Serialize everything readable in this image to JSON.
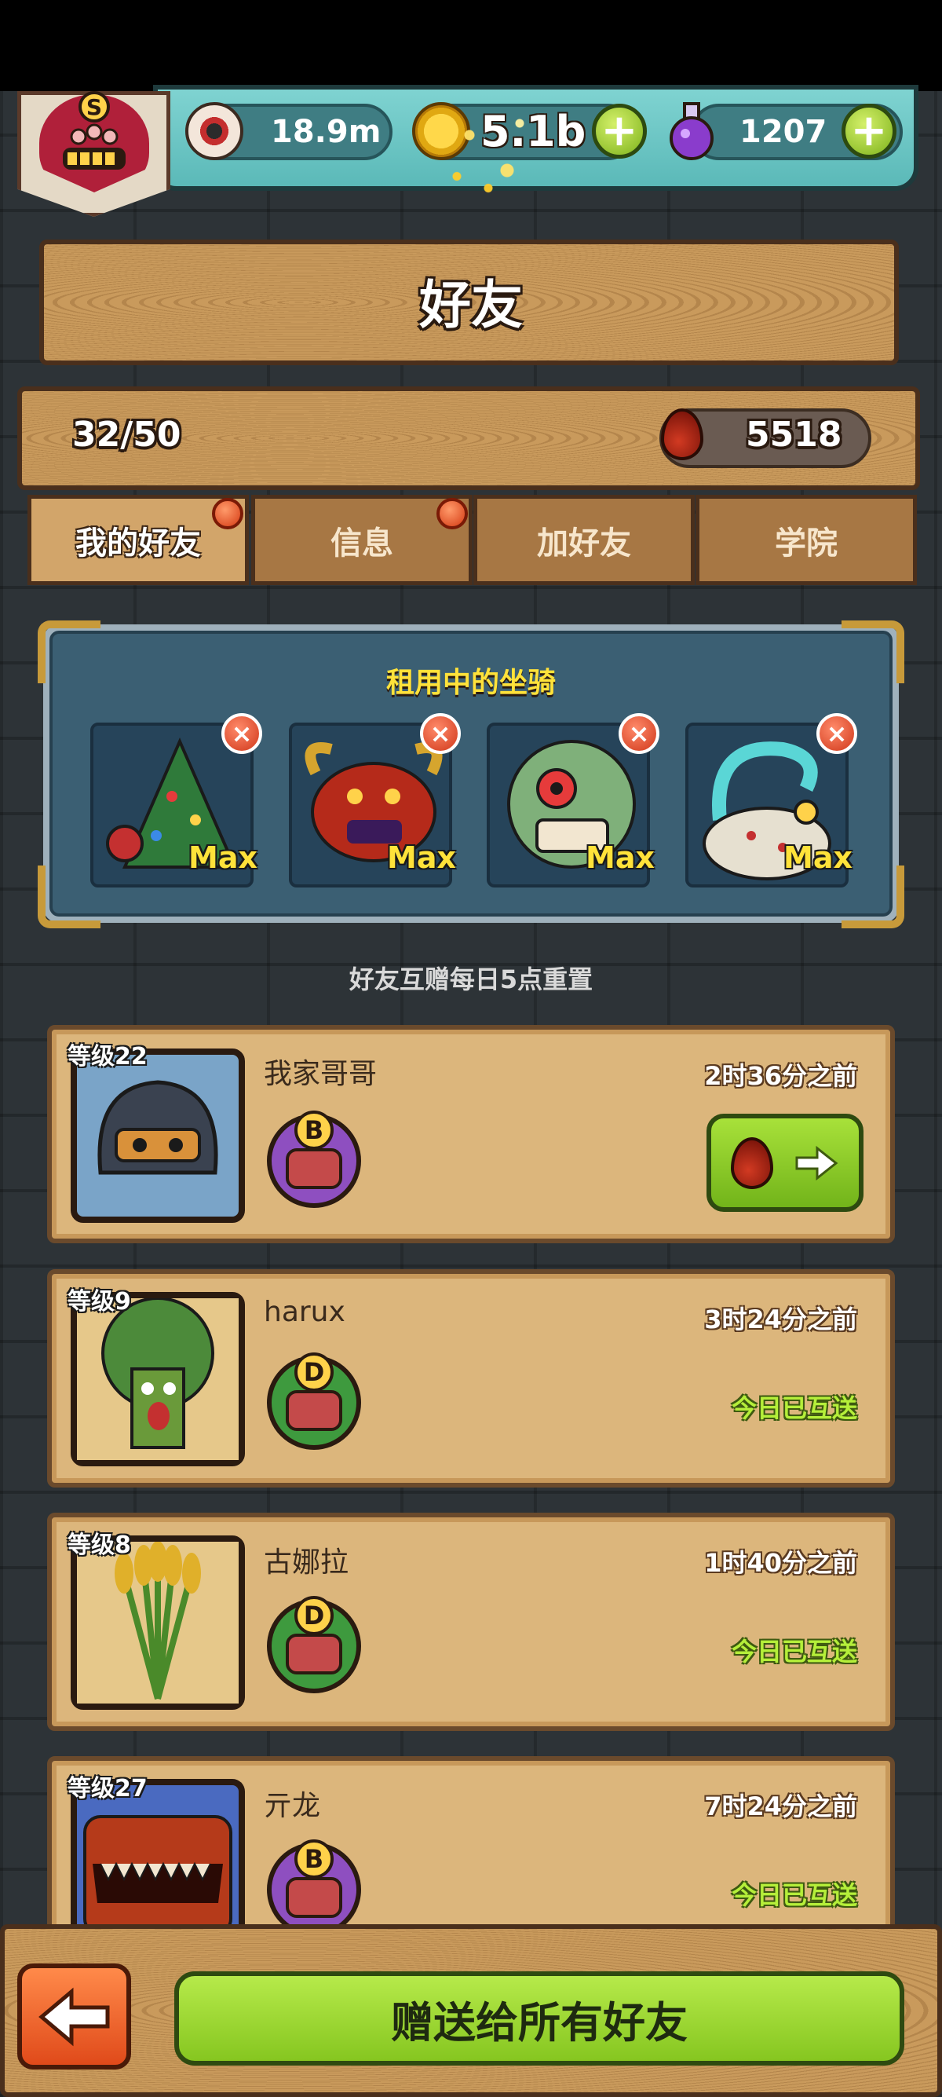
{
  "resources": {
    "eyes": "18.9m",
    "coins": "5.1b",
    "potions": "1207"
  },
  "page_title": "好友",
  "friend_count": "32/50",
  "blood_drops": "5518",
  "tabs": [
    {
      "label": "我的好友",
      "active": true,
      "notification": true
    },
    {
      "label": "信息",
      "active": false,
      "notification": true
    },
    {
      "label": "加好友",
      "active": false,
      "notification": false
    },
    {
      "label": "学院",
      "active": false,
      "notification": false
    }
  ],
  "mounts": {
    "title": "租用中的坐骑",
    "items": [
      {
        "name": "christmas-tree-monster",
        "level": "Max"
      },
      {
        "name": "horned-demon-monster",
        "level": "Max"
      },
      {
        "name": "lion-dance-monster",
        "level": "Max"
      },
      {
        "name": "snail-blob-monster",
        "level": "Max"
      }
    ]
  },
  "reset_note": "好友互赠每日5点重置",
  "friends": [
    {
      "level": "等级22",
      "name": "我家哥哥",
      "time": "2时36分之前",
      "rank": "B",
      "status": "gift_button"
    },
    {
      "level": "等级9",
      "name": "harux",
      "time": "3时24分之前",
      "rank": "D",
      "status": "今日已互送"
    },
    {
      "level": "等级8",
      "name": "古娜拉",
      "time": "1时40分之前",
      "rank": "D",
      "status": "今日已互送"
    },
    {
      "level": "等级27",
      "name": "亓龙",
      "time": "7时24分之前",
      "rank": "B",
      "status": "今日已互送"
    }
  ],
  "give_all_label": "赠送给所有好友",
  "colors": {
    "accent_green": "#86c620",
    "accent_orange": "#e04a1a",
    "sent_text": "#b5ef3a",
    "mount_title": "#ffe23a"
  }
}
